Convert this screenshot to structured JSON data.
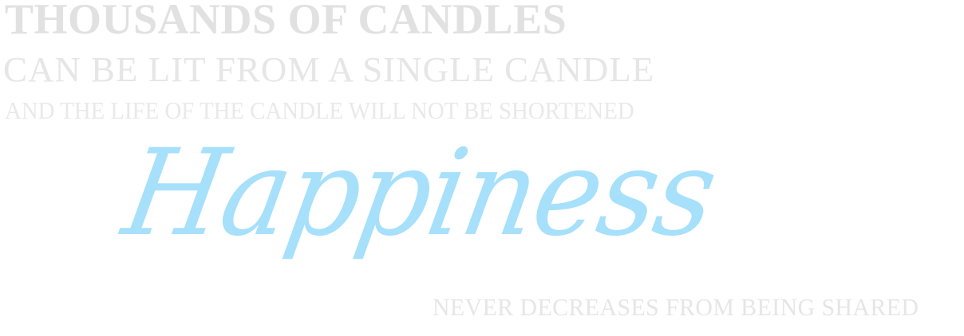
{
  "quote": {
    "line_1": "THOUSANDS OF CANDLES",
    "line_2": "CAN BE LIT FROM A SINGLE CANDLE",
    "line_3": "AND THE LIFE OF THE CANDLE WILL NOT BE SHORTENED",
    "hero_word": "Happiness",
    "line_4": "NEVER DECREASES FROM BEING SHARED"
  },
  "colors": {
    "grey_text": "#e3e3e3",
    "hero_blue": "#a6e0fb",
    "background": "#ffffff"
  }
}
